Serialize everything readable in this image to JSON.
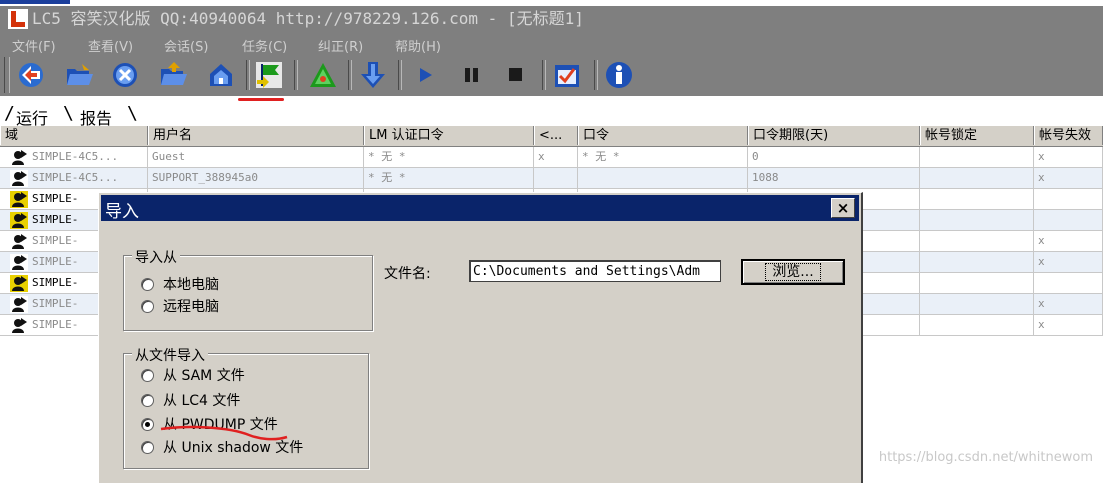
{
  "window": {
    "title": "LC5 容笑汉化版 QQ:40940064 http://978229.126.com - [无标题1]"
  },
  "menu": [
    {
      "label": "文件(F)"
    },
    {
      "label": "查看(V)"
    },
    {
      "label": "会话(S)"
    },
    {
      "label": "任务(C)"
    },
    {
      "label": "纠正(R)"
    },
    {
      "label": "帮助(H)"
    }
  ],
  "toolbar": {
    "buttons": [
      {
        "icon": "session-wizard-icon"
      },
      {
        "icon": "open-folder-icon"
      },
      {
        "icon": "close-session-icon"
      },
      {
        "icon": "open-session-icon"
      },
      {
        "icon": "save-session-icon"
      },
      {
        "icon": "import-flag-icon"
      },
      {
        "icon": "triangle-options-icon"
      },
      {
        "icon": "download-arrow-icon"
      },
      {
        "icon": "play-icon"
      },
      {
        "icon": "pause-icon"
      },
      {
        "icon": "stop-icon"
      },
      {
        "icon": "report-checkbox-icon"
      },
      {
        "icon": "info-icon"
      }
    ]
  },
  "tabs": [
    {
      "label": "运行"
    },
    {
      "label": "报告"
    }
  ],
  "grid": {
    "columns": [
      "域",
      "用户名",
      "LM 认证口令",
      "<...",
      "口令",
      "口令期限(天)",
      "帐号锁定",
      "帐号失效"
    ],
    "rows": [
      {
        "domain": "SIMPLE-4C5...",
        "user": "Guest",
        "lm": "* 无     *",
        "flag": "x",
        "pwd": "* 无     *",
        "age": "0",
        "locked": "",
        "disabled": "x",
        "dark": false
      },
      {
        "domain": "SIMPLE-4C5...",
        "user": "SUPPORT_388945a0",
        "lm": "* 无     *",
        "flag": "",
        "pwd": "",
        "age": "1088",
        "locked": "",
        "disabled": "x",
        "dark": false
      },
      {
        "domain": "SIMPLE-",
        "dark": true,
        "disabled": ""
      },
      {
        "domain": "SIMPLE-",
        "dark": true,
        "disabled": ""
      },
      {
        "domain": "SIMPLE-",
        "dark": false,
        "disabled": "x"
      },
      {
        "domain": "SIMPLE-",
        "dark": false,
        "disabled": "x"
      },
      {
        "domain": "SIMPLE-",
        "dark": true,
        "disabled": ""
      },
      {
        "domain": "SIMPLE-",
        "dark": false,
        "disabled": "x"
      },
      {
        "domain": "SIMPLE-",
        "dark": false,
        "disabled": "x"
      }
    ]
  },
  "dialog": {
    "title": "导入",
    "close": "×",
    "import_from": {
      "legend": "导入从",
      "options": [
        {
          "label": "本地电脑"
        },
        {
          "label": "远程电脑"
        }
      ]
    },
    "file_label": "文件名:",
    "file_value": "C:\\Documents and Settings\\Adm",
    "browse_label": "浏览...",
    "from_file": {
      "legend": "从文件导入",
      "options": [
        {
          "label": "从 SAM 文件"
        },
        {
          "label": "从 LC4 文件"
        },
        {
          "label": "从 PWDUMP 文件"
        },
        {
          "label": "从 Unix shadow 文件"
        }
      ],
      "selected": 2
    }
  },
  "watermark": "https://blog.csdn.net/whitnewom"
}
